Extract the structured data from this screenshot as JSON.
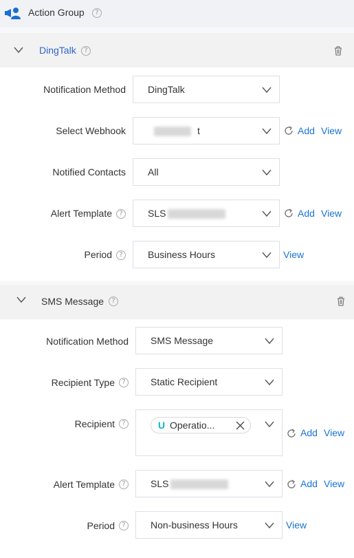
{
  "header": {
    "title": "Action Group",
    "help": "?"
  },
  "dingtalk": {
    "title": "DingTalk",
    "help": "?",
    "rows": {
      "method": {
        "label": "Notification Method",
        "value": "DingTalk"
      },
      "webhook": {
        "label": "Select Webhook",
        "value_suffix": "t"
      },
      "contacts": {
        "label": "Notified Contacts",
        "value": "All"
      },
      "template": {
        "label": "Alert Template",
        "value": "SLS"
      },
      "period": {
        "label": "Period",
        "value": "Business Hours"
      }
    },
    "links": {
      "add": "Add",
      "view": "View"
    }
  },
  "sms": {
    "title": "SMS Message",
    "help": "?",
    "rows": {
      "method": {
        "label": "Notification Method",
        "value": "SMS Message"
      },
      "recipient_type": {
        "label": "Recipient Type",
        "value": "Static Recipient"
      },
      "recipient": {
        "label": "Recipient",
        "tag_icon": "U",
        "tag_text": "Operatio..."
      },
      "template": {
        "label": "Alert Template",
        "value": "SLS"
      },
      "period": {
        "label": "Period",
        "value": "Non-business Hours"
      }
    },
    "links": {
      "add": "Add",
      "view": "View"
    }
  },
  "colors": {
    "link": "#1773d4",
    "title_link": "#2d66c8",
    "tag_icon": "#12b5c7"
  },
  "icons": [
    "action-group-icon",
    "help-icon",
    "collapse-chevron-icon",
    "trash-icon",
    "chevron-down-icon",
    "refresh-icon",
    "close-icon"
  ]
}
